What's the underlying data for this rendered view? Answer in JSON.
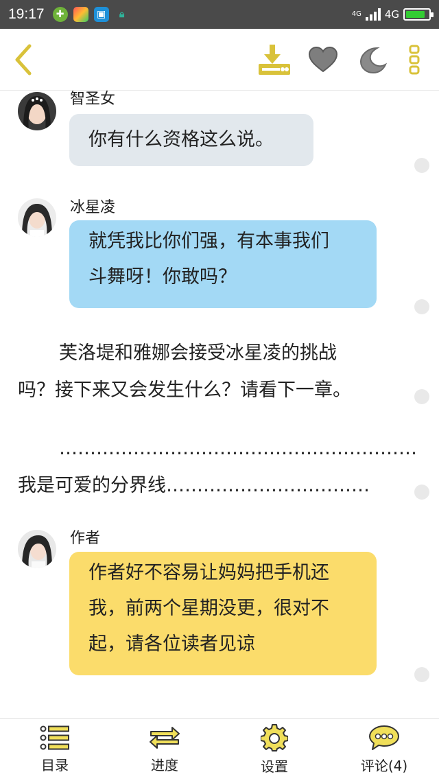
{
  "status_bar": {
    "time": "19:17",
    "network": "4G",
    "network_small": "4G"
  },
  "toolbar": {
    "back_icon": "chevron-left-icon",
    "download_icon": "download-icon",
    "favorite_icon": "heart-icon",
    "night_mode_icon": "moon-icon",
    "more_icon": "more-vertical-icon",
    "accent": "#d9c23a"
  },
  "messages": [
    {
      "speaker": "智圣女",
      "text": "你有什么资格这么说。",
      "color": "#e2e8ed"
    },
    {
      "speaker": "冰星凌",
      "lines": [
        "就凭我比你们强，有本事我们",
        "斗舞呀！你敢吗？"
      ],
      "color": "#a3d9f5"
    },
    {
      "narration_lines": [
        "芙洛堤和雅娜会接受冰星凌的挑战",
        "吗？接下来又会发生什么？请看下一章。"
      ]
    },
    {
      "divider_lines": [
        "………………………………………………………",
        "我是可爱的分界线……………………………"
      ]
    },
    {
      "speaker": "作者",
      "lines": [
        "作者好不容易让妈妈把手机还",
        "我，前两个星期没更，很对不",
        "起，请各位读者见谅"
      ],
      "color": "#fbdc6b"
    }
  ],
  "bottom_nav": [
    {
      "label": "目录",
      "icon": "list-icon"
    },
    {
      "label": "进度",
      "icon": "arrows-swap-icon"
    },
    {
      "label": "设置",
      "icon": "gear-icon"
    },
    {
      "label": "评论(4)",
      "icon": "chat-bubble-icon"
    }
  ]
}
